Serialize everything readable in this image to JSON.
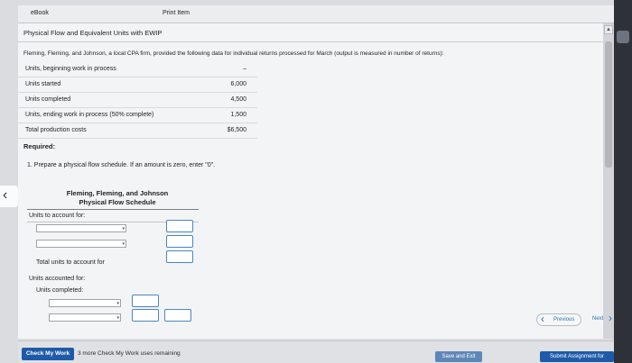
{
  "tabs": {
    "ebook": "eBook",
    "print": "Print Item"
  },
  "problem": {
    "title": "Physical Flow and Equivalent Units with EWIP",
    "intro": "Fleming, Fleming, and Johnson, a local CPA firm, provided the following data for individual returns processed for March (output is measured in number of returns):",
    "rows": [
      {
        "label": "Units, beginning work in process",
        "value": "–"
      },
      {
        "label": "Units started",
        "value": "6,000"
      },
      {
        "label": "Units completed",
        "value": "4,500"
      },
      {
        "label": "Units, ending work in process (50% complete)",
        "value": "1,500"
      },
      {
        "label": "Total production costs",
        "value": "$6,500"
      }
    ],
    "required_label": "Required:",
    "question": "1. Prepare a physical flow schedule. If an amount is zero, enter \"0\"."
  },
  "schedule": {
    "company": "Fleming, Fleming, and Johnson",
    "title": "Physical Flow Schedule",
    "to_account_label": "Units to account for:",
    "total_label": "Total units to account for",
    "accounted_label": "Units accounted for:",
    "completed_label": "Units completed:"
  },
  "nav": {
    "previous": "Previous",
    "next": "Next"
  },
  "footer": {
    "check_button": "Check My Work",
    "remaining": "3 more Check My Work uses remaining",
    "save_button": "Save and Exit",
    "submit_button": "Submit Assignment for Grading"
  },
  "colors": {
    "primary": "#1e5aa8",
    "input_border": "#4a86c5",
    "link": "#2f6fb0"
  },
  "icons": {
    "nav_left": "chevron-left-icon",
    "nav_right": "chevron-right-icon",
    "select": "dropdown-arrow-icon"
  }
}
